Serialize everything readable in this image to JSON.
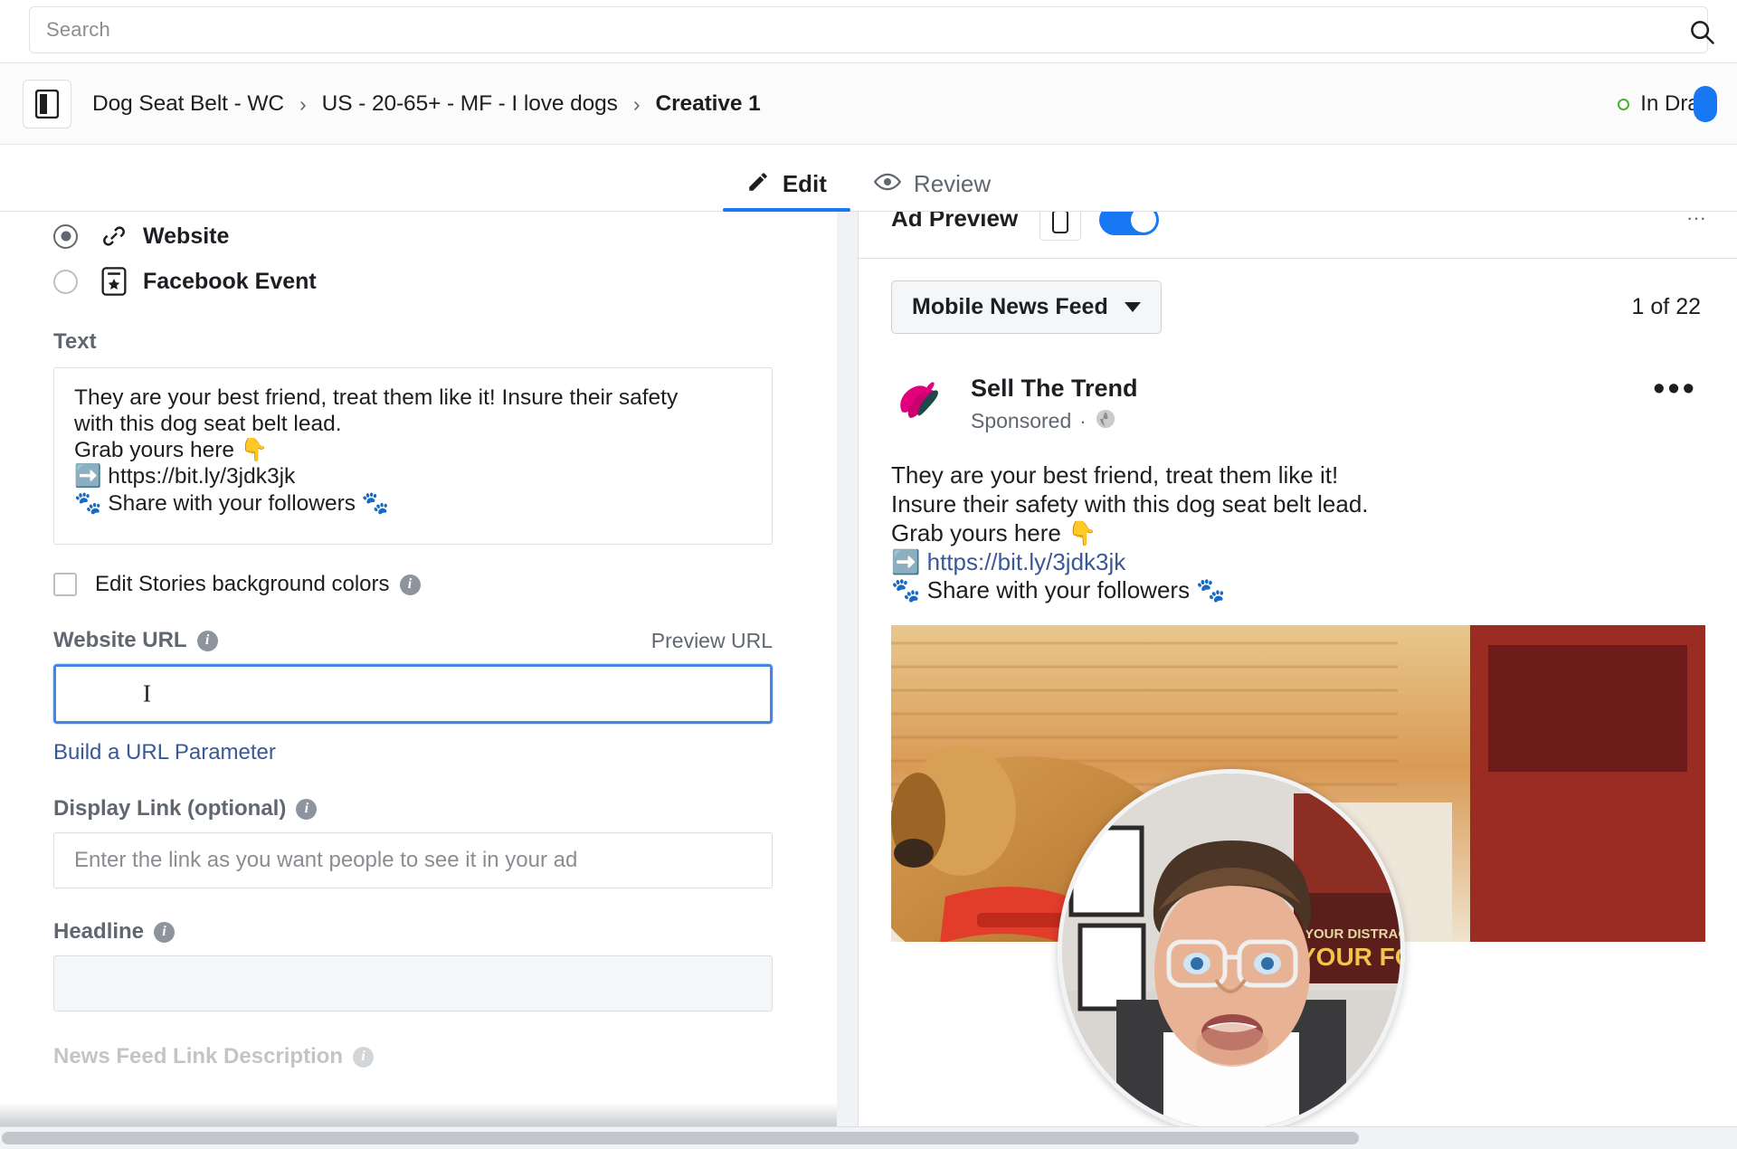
{
  "search": {
    "placeholder": "Search",
    "icon": "search-icon"
  },
  "breadcrumb": {
    "doc_icon": "ad-creative-icon",
    "items": [
      {
        "label": "Dog Seat Belt - WC",
        "current": false
      },
      {
        "label": "US - 20-65+ - MF - I love dogs",
        "current": false
      },
      {
        "label": "Creative 1",
        "current": true
      }
    ],
    "separator": "›",
    "status": {
      "label": "In Draft",
      "dot_color": "#42b72a"
    }
  },
  "tabs": [
    {
      "label": "Edit",
      "icon": "pencil-icon",
      "active": true
    },
    {
      "label": "Review",
      "icon": "eye-icon",
      "active": false
    }
  ],
  "form": {
    "destination": {
      "options": [
        {
          "label": "Website",
          "icon": "link-icon",
          "selected": true
        },
        {
          "label": "Facebook Event",
          "icon": "event-icon",
          "selected": false
        }
      ]
    },
    "text_field": {
      "label": "Text",
      "lines": [
        "They are your best friend, treat them like it!  Insure their safety",
        "with this dog seat belt lead.",
        "Grab yours here 👇",
        "➡️ https://bit.ly/3jdk3jk",
        "🐾 Share with your followers 🐾"
      ]
    },
    "stories_checkbox": {
      "label": "Edit Stories background colors",
      "checked": false,
      "info": "info-icon"
    },
    "website_url": {
      "label": "Website URL",
      "value": "",
      "focused": true,
      "preview_link": "Preview URL",
      "build_param_link": "Build a URL Parameter"
    },
    "display_link": {
      "label": "Display Link (optional)",
      "placeholder": "Enter the link as you want people to see it in your ad",
      "value": ""
    },
    "headline": {
      "label": "Headline",
      "value": ""
    },
    "news_feed_link_description": {
      "label": "News Feed Link Description"
    }
  },
  "preview": {
    "panel_title": "Ad Preview",
    "mobile_icon": "mobile-icon",
    "toggle_on": true,
    "placement_select": "Mobile News Feed",
    "count": "1 of 22",
    "ad": {
      "brand": "Sell The Trend",
      "sponsored": "Sponsored",
      "globe_icon": "globe-icon",
      "more_icon": "more-options-icon",
      "lines": [
        "They are your best friend, treat them like it!",
        "Insure their safety with this dog seat belt lead.",
        "Grab yours here 👇"
      ],
      "url_line": "https://bit.ly/3jdk3jk",
      "url_emoji": "➡️",
      "share_line": "Share with your followers",
      "paw_emoji": "🐾"
    },
    "media": {
      "alt": "golden retriever dog wearing red seat belt harness in car"
    },
    "webcam_overlay": {
      "alt": "presenter speaking to camera with office wall art"
    }
  },
  "colors": {
    "accent": "#1877f2",
    "link": "#385898",
    "status_green": "#42b72a",
    "brand_pink": "#e3007f"
  }
}
